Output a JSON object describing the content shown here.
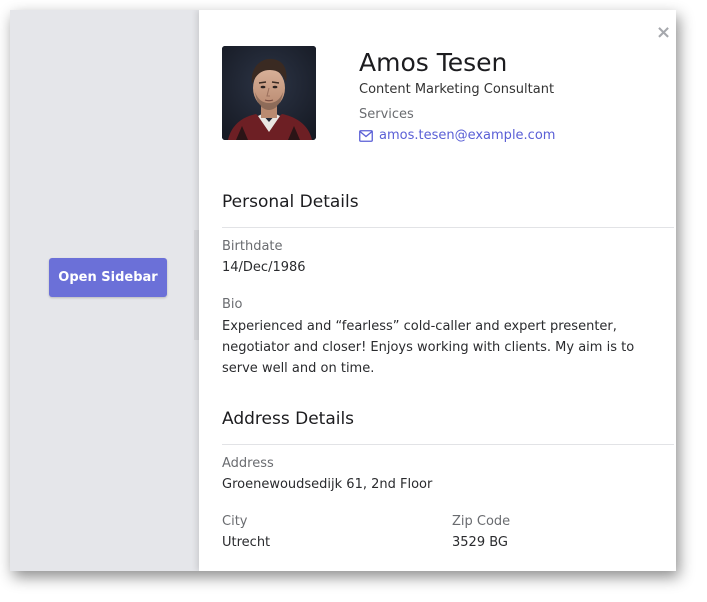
{
  "sidebar_trigger": {
    "label": "Open Sidebar",
    "color": "#6b70d8"
  },
  "panel": {
    "close_icon": "close-icon",
    "profile": {
      "name": "Amos Tesen",
      "job_title": "Content Marketing Consultant",
      "department": "Services",
      "email": "amos.tesen@example.com",
      "email_icon": "mail-icon",
      "link_color": "#5a5fd6"
    },
    "personal": {
      "heading": "Personal Details",
      "birthdate_label": "Birthdate",
      "birthdate": "14/Dec/1986",
      "bio_label": "Bio",
      "bio": "Experienced and “fearless” cold-caller and expert presenter, negotiator and closer! Enjoys working with clients. My aim is to serve well and on time."
    },
    "address": {
      "heading": "Address Details",
      "address_label": "Address",
      "address": "Groenewoudsedijk 61, 2nd Floor",
      "city_label": "City",
      "city": "Utrecht",
      "zip_label": "Zip Code",
      "zip": "3529 BG"
    }
  }
}
